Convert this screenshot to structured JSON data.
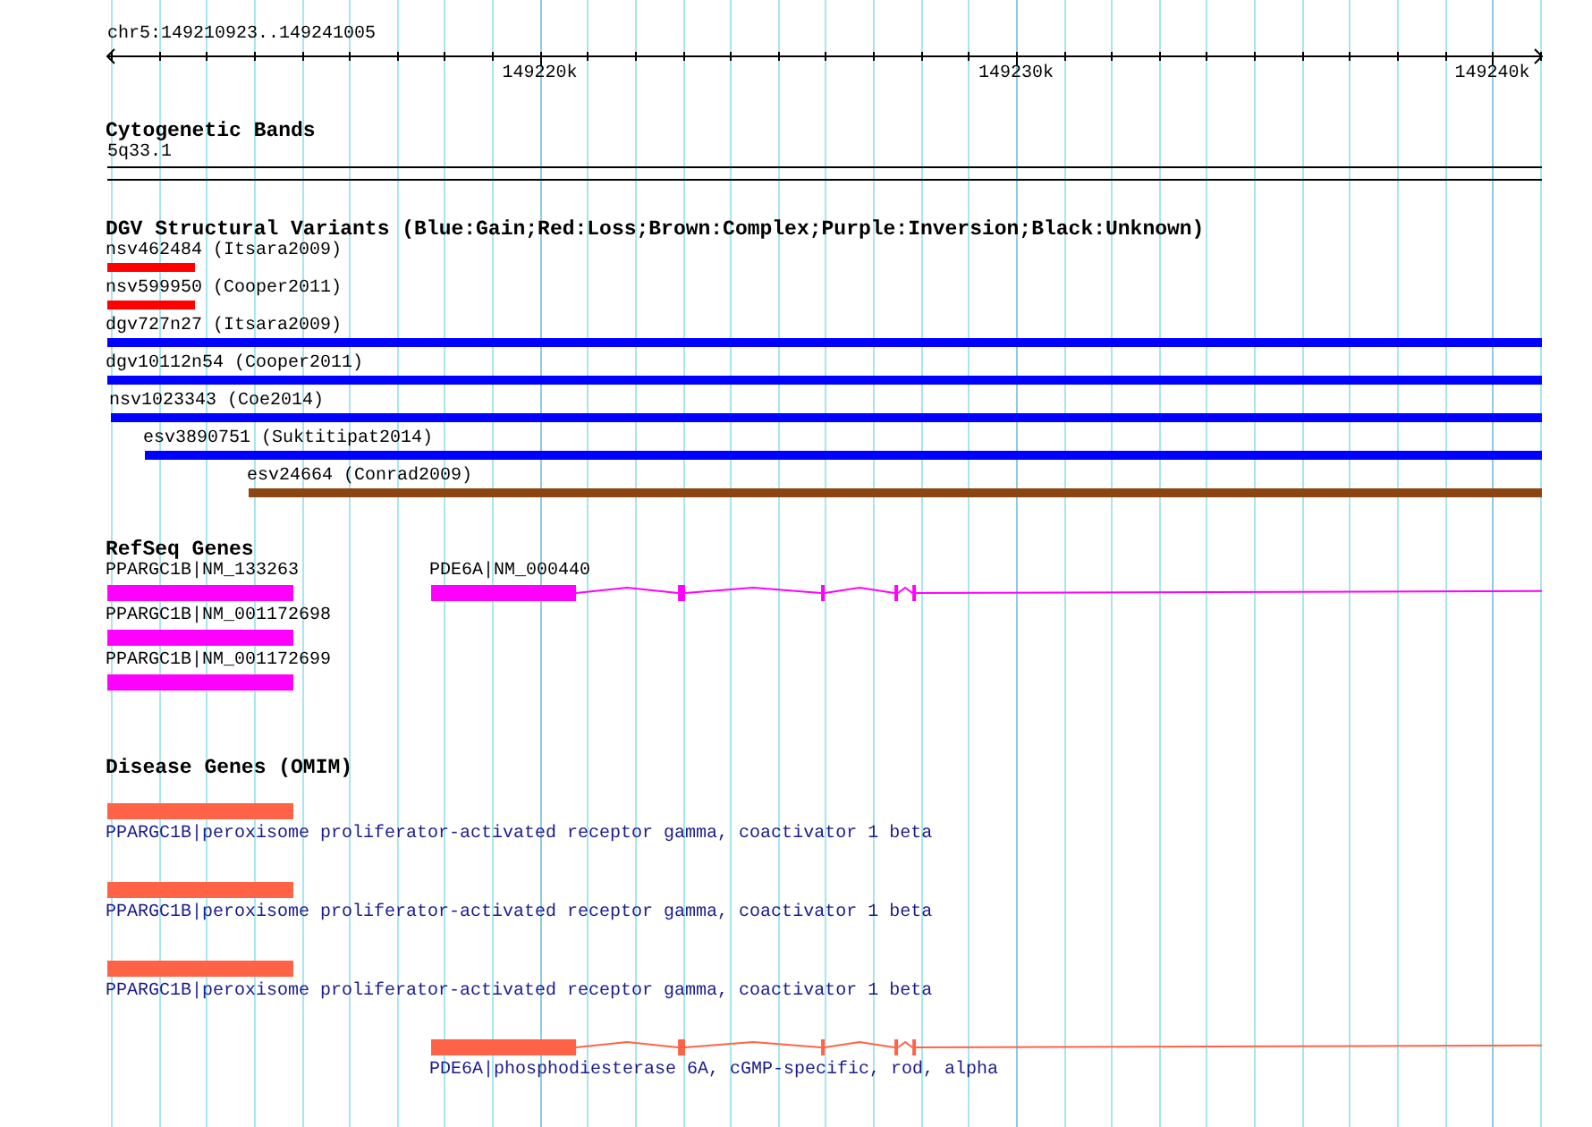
{
  "range": {
    "label": "chr5:149210923..149241005"
  },
  "ruler": {
    "ticks": [
      {
        "label": "149220k"
      },
      {
        "label": "149230k"
      },
      {
        "label": "149240k"
      }
    ]
  },
  "tracks": [
    {
      "kind": "cytoband",
      "title": "Cytogenetic Bands",
      "bands": [
        {
          "label": "5q33.1"
        }
      ]
    },
    {
      "kind": "variants",
      "title": "DGV Structural Variants (Blue:Gain;Red:Loss;Brown:Complex;Purple:Inversion;Black:Unknown)",
      "rows": [
        [
          {
            "label": "nsv462484 (Itsara2009)",
            "color": "#ff0000"
          }
        ],
        [
          {
            "label": "nsv599950 (Cooper2011)",
            "color": "#ff0000"
          }
        ],
        [
          {
            "label": "dgv727n27 (Itsara2009)",
            "color": "#0000ff"
          }
        ],
        [
          {
            "label": "dgv10112n54 (Cooper2011)",
            "color": "#0000ff"
          }
        ],
        [
          {
            "label": "nsv1023343 (Coe2014)",
            "color": "#0000ff"
          }
        ],
        [
          {
            "label": "esv3890751 (Suktitipat2014)",
            "color": "#0000ff"
          }
        ],
        [
          {
            "label": "esv24664 (Conrad2009)",
            "color": "#8b4513"
          }
        ]
      ]
    },
    {
      "kind": "genes",
      "title": "RefSeq Genes",
      "color": "#ff00ff",
      "rows": [
        [
          {
            "label": "PPARGC1B|NM_133263",
            "kind": "block"
          },
          {
            "label": "PDE6A|NM_000440",
            "kind": "transcript"
          }
        ],
        [
          {
            "label": "PPARGC1B|NM_001172698",
            "kind": "block"
          }
        ],
        [
          {
            "label": "PPARGC1B|NM_001172699",
            "kind": "block"
          }
        ]
      ]
    },
    {
      "kind": "disease",
      "title": "Disease Genes (OMIM)",
      "color": "#ff6347",
      "rows": [
        [
          {
            "label": "PPARGC1B|peroxisome proliferator-activated receptor gamma, coactivator 1 beta",
            "kind": "block"
          }
        ],
        [
          {
            "label": "PPARGC1B|peroxisome proliferator-activated receptor gamma, coactivator 1 beta",
            "kind": "block"
          }
        ],
        [
          {
            "label": "PPARGC1B|peroxisome proliferator-activated receptor gamma, coactivator 1 beta",
            "kind": "block"
          }
        ],
        [
          {
            "label": "PDE6A|phosphodiesterase 6A, cGMP-specific, rod, alpha",
            "kind": "transcript"
          }
        ]
      ]
    }
  ]
}
